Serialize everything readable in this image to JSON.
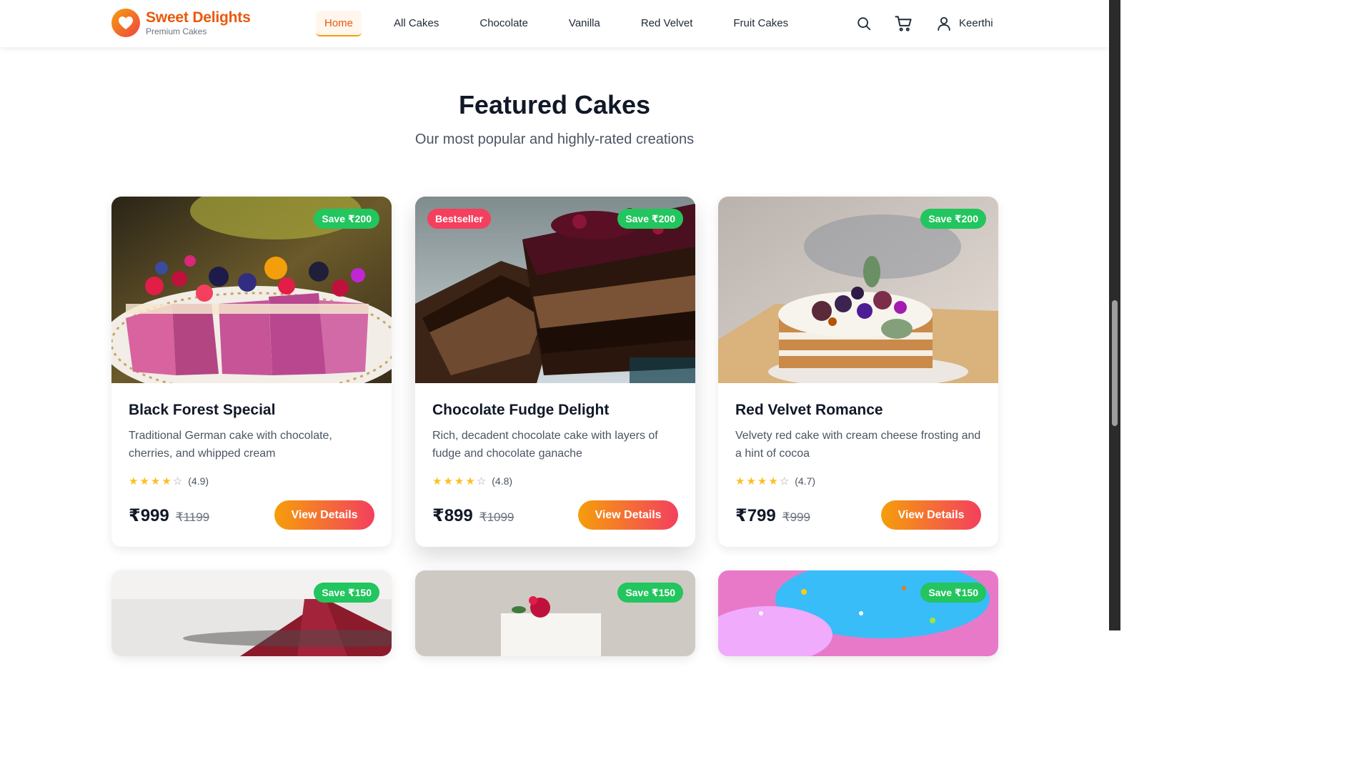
{
  "header": {
    "logo_title": "Sweet Delights",
    "logo_subtitle": "Premium Cakes",
    "logo_icon": "heart-icon",
    "nav": [
      "Home",
      "All Cakes",
      "Chocolate",
      "Vanilla",
      "Red Velvet",
      "Fruit Cakes"
    ],
    "active_nav": "Home",
    "icons": [
      "search-icon",
      "cart-icon",
      "user-icon"
    ],
    "user_name": "Keerthi"
  },
  "section": {
    "title": "Featured Cakes",
    "subtitle": "Our most popular and highly-rated creations"
  },
  "cards": [
    {
      "save": "Save ₹200",
      "badge": "",
      "title": "Black Forest Special",
      "desc": "Traditional German cake with chocolate, cherries, and whipped cream",
      "stars": 4,
      "rating": "(4.9)",
      "price": "₹999",
      "old_price": "₹1199",
      "button": "View Details"
    },
    {
      "save": "Save ₹200",
      "badge": "Bestseller",
      "title": "Chocolate Fudge Delight",
      "desc": "Rich, decadent chocolate cake with layers of fudge and chocolate ganache",
      "stars": 4,
      "rating": "(4.8)",
      "price": "₹899",
      "old_price": "₹1099",
      "button": "View Details"
    },
    {
      "save": "Save ₹200",
      "badge": "",
      "title": "Red Velvet Romance",
      "desc": "Velvety red cake with cream cheese frosting and a hint of cocoa",
      "stars": 4,
      "rating": "(4.7)",
      "price": "₹799",
      "old_price": "₹999",
      "button": "View Details"
    },
    {
      "save": "Save ₹150"
    },
    {
      "save": "Save ₹150"
    },
    {
      "save": "Save ₹150"
    }
  ],
  "colors": {
    "brand": "#ea580c",
    "save_badge": "#22c55e",
    "bestseller_badge": "#f43f5e",
    "button_from": "#f59e0b",
    "button_to": "#f43f5e",
    "star": "#fbbf24"
  }
}
